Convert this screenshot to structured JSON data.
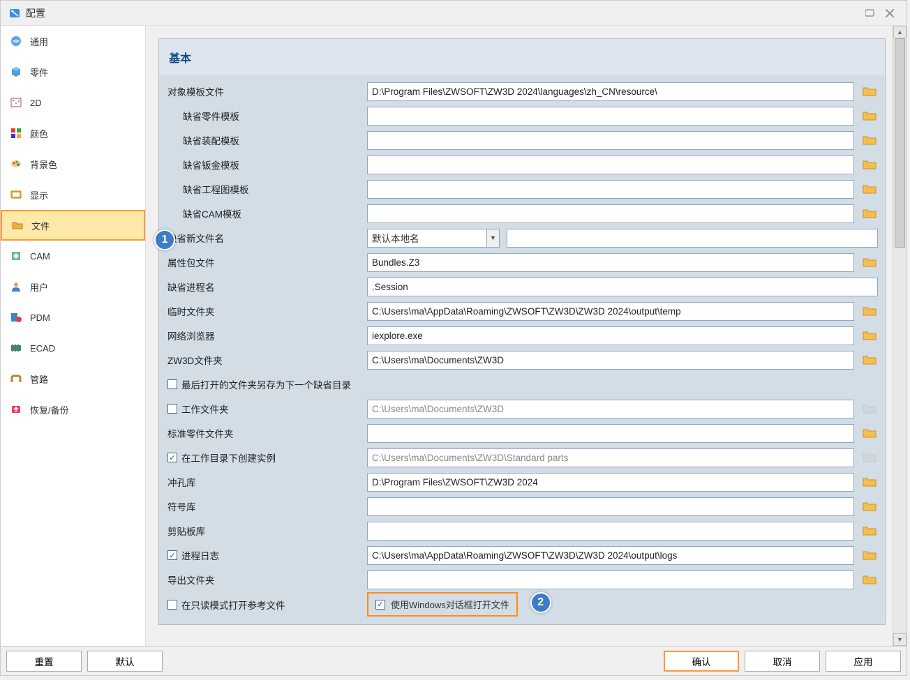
{
  "titlebar": {
    "title": "配置"
  },
  "sidebar": {
    "items": [
      {
        "label": "通用",
        "icon": "general"
      },
      {
        "label": "零件",
        "icon": "part"
      },
      {
        "label": "2D",
        "icon": "2d"
      },
      {
        "label": "颜色",
        "icon": "color"
      },
      {
        "label": "背景色",
        "icon": "bgcolor"
      },
      {
        "label": "显示",
        "icon": "display"
      },
      {
        "label": "文件",
        "icon": "file",
        "selected": true
      },
      {
        "label": "CAM",
        "icon": "cam"
      },
      {
        "label": "用户",
        "icon": "user"
      },
      {
        "label": "PDM",
        "icon": "pdm"
      },
      {
        "label": "ECAD",
        "icon": "ecad"
      },
      {
        "label": "管路",
        "icon": "routing"
      },
      {
        "label": "恢复/备份",
        "icon": "backup"
      }
    ]
  },
  "panel": {
    "title": "基本",
    "rows": {
      "obj_template": {
        "label": "对象模板文件",
        "value": "D:\\Program Files\\ZWSOFT\\ZW3D 2024\\languages\\zh_CN\\resource\\"
      },
      "def_part_tpl": {
        "label": "缺省零件模板",
        "value": ""
      },
      "def_asm_tpl": {
        "label": "缺省装配模板",
        "value": ""
      },
      "def_sheet_tpl": {
        "label": "缺省钣金模板",
        "value": ""
      },
      "def_drawing_tpl": {
        "label": "缺省工程图模板",
        "value": ""
      },
      "def_cam_tpl": {
        "label": "缺省CAM模板",
        "value": ""
      },
      "def_newfile": {
        "label": "缺省新文件名",
        "select": "默认本地名",
        "value": ""
      },
      "bundle": {
        "label": "属性包文件",
        "value": "Bundles.Z3"
      },
      "def_process": {
        "label": "缺省进程名",
        "value": ".Session"
      },
      "temp_folder": {
        "label": "临时文件夹",
        "value": "C:\\Users\\ma\\AppData\\Roaming\\ZWSOFT\\ZW3D\\ZW3D 2024\\output\\temp"
      },
      "browser": {
        "label": "网络浏览器",
        "value": "iexplore.exe"
      },
      "zw3d_folder": {
        "label": "ZW3D文件夹",
        "value": "C:\\Users\\ma\\Documents\\ZW3D"
      },
      "save_last_folder": {
        "label": "最后打开的文件夹另存为下一个缺省目录",
        "checked": false
      },
      "work_folder": {
        "label": "工作文件夹",
        "value": "C:\\Users\\ma\\Documents\\ZW3D",
        "checked": false
      },
      "std_part_folder": {
        "label": "标准零件文件夹",
        "value": ""
      },
      "create_in_work": {
        "label": "在工作目录下创建实例",
        "value": "C:\\Users\\ma\\Documents\\ZW3D\\Standard parts",
        "checked": true
      },
      "punch_lib": {
        "label": "冲孔库",
        "value": "D:\\Program Files\\ZWSOFT\\ZW3D 2024"
      },
      "symbol_lib": {
        "label": "符号库",
        "value": ""
      },
      "clip_lib": {
        "label": "剪贴板库",
        "value": ""
      },
      "process_log": {
        "label": "进程日志",
        "value": "C:\\Users\\ma\\AppData\\Roaming\\ZWSOFT\\ZW3D\\ZW3D 2024\\output\\logs",
        "checked": true
      },
      "export_folder": {
        "label": "导出文件夹",
        "value": ""
      },
      "readonly_ref": {
        "label": "在只读模式打开参考文件",
        "checked": false
      },
      "use_win_dialog": {
        "label": "使用Windows对话框打开文件",
        "checked": true
      }
    }
  },
  "badges": {
    "b1": "1",
    "b2": "2"
  },
  "footer": {
    "reset": "重置",
    "default": "默认",
    "ok": "确认",
    "cancel": "取消",
    "apply": "应用"
  }
}
